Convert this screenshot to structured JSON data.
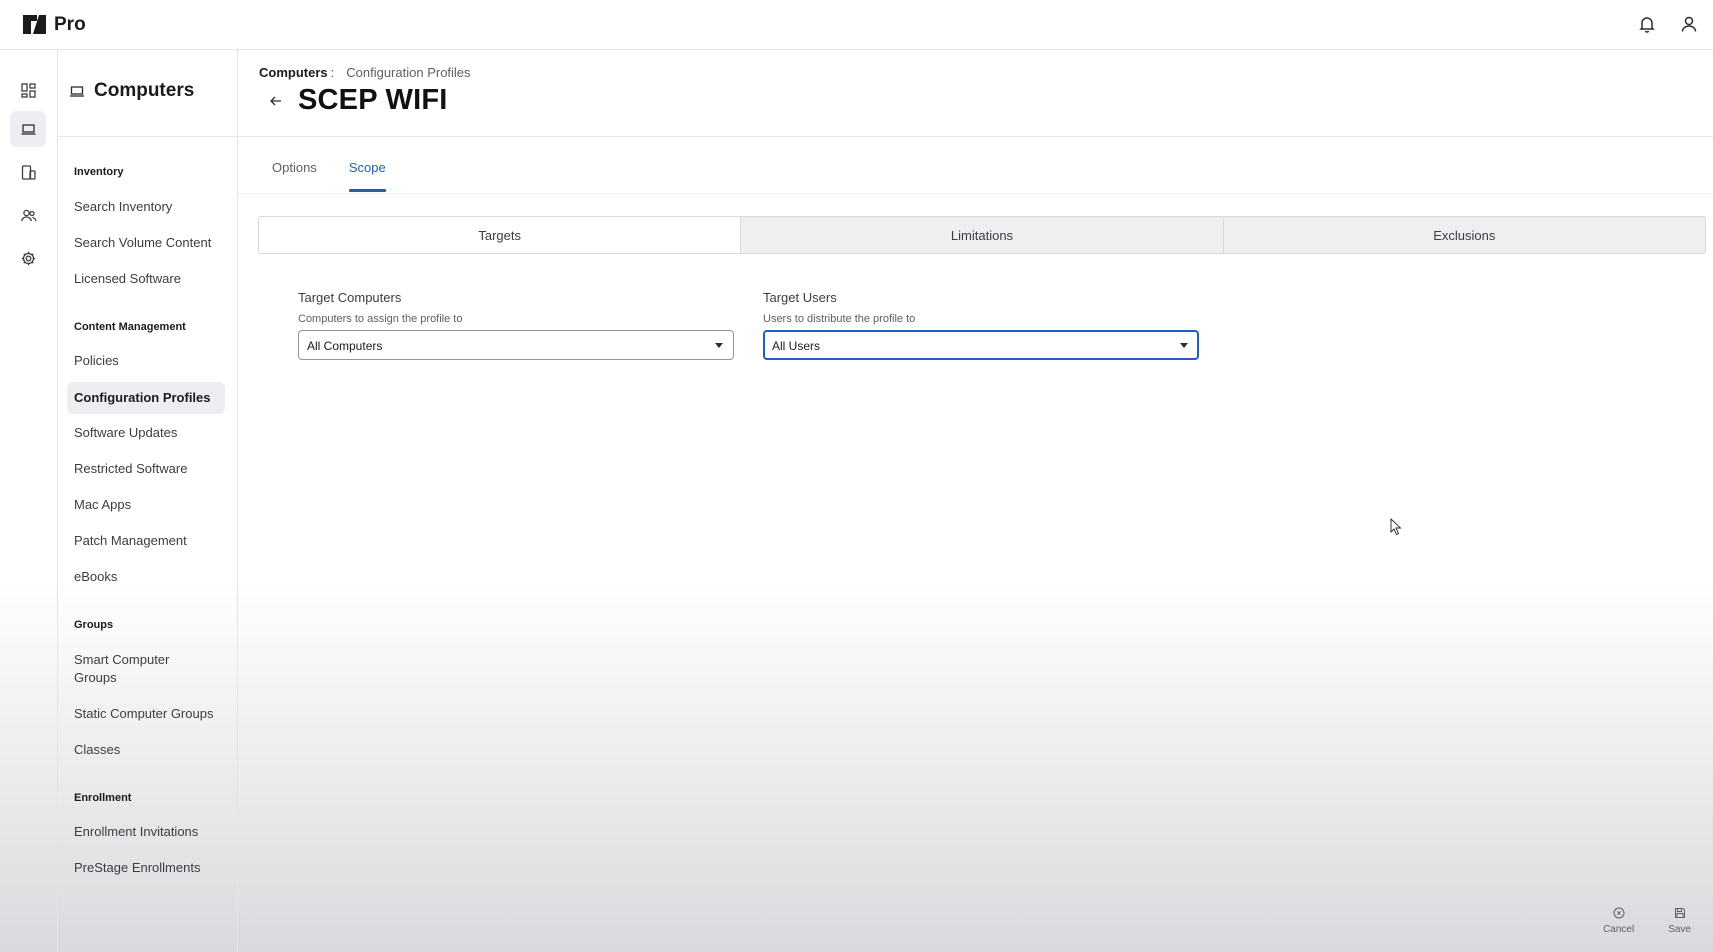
{
  "app": {
    "name": "Pro"
  },
  "section": {
    "title": "Computers"
  },
  "sidebar": {
    "groups": [
      {
        "title": "Inventory",
        "items": [
          "Search Inventory",
          "Search Volume Content",
          "Licensed Software"
        ]
      },
      {
        "title": "Content Management",
        "items": [
          "Policies",
          "Configuration Profiles",
          "Software Updates",
          "Restricted Software",
          "Mac Apps",
          "Patch Management",
          "eBooks"
        ]
      },
      {
        "title": "Groups",
        "items": [
          "Smart Computer Groups",
          "Static Computer Groups",
          "Classes"
        ]
      },
      {
        "title": "Enrollment",
        "items": [
          "Enrollment Invitations",
          "PreStage Enrollments"
        ]
      }
    ],
    "active_item": "Configuration Profiles"
  },
  "breadcrumb": {
    "parent": "Computers",
    "separator": ":",
    "current": "Configuration Profiles"
  },
  "page": {
    "title": "SCEP WIFI"
  },
  "tabs": [
    {
      "label": "Options",
      "active": false
    },
    {
      "label": "Scope",
      "active": true
    }
  ],
  "scope_segments": [
    {
      "label": "Targets",
      "active": true
    },
    {
      "label": "Limitations",
      "active": false
    },
    {
      "label": "Exclusions",
      "active": false
    }
  ],
  "targets": {
    "computers": {
      "label": "Target Computers",
      "help": "Computers to assign the profile to",
      "value": "All Computers"
    },
    "users": {
      "label": "Target Users",
      "help": "Users to distribute the profile to",
      "value": "All Users"
    }
  },
  "footer": {
    "cancel_label": "Cancel",
    "save_label": "Save"
  },
  "colors": {
    "accent": "#1f5fb8",
    "active_bg": "#eceef1"
  },
  "icons": {
    "rail": [
      "dashboard-icon",
      "computers-icon",
      "devices-icon",
      "users-icon",
      "settings-icon"
    ],
    "top": [
      "bell-icon",
      "user-icon"
    ]
  }
}
